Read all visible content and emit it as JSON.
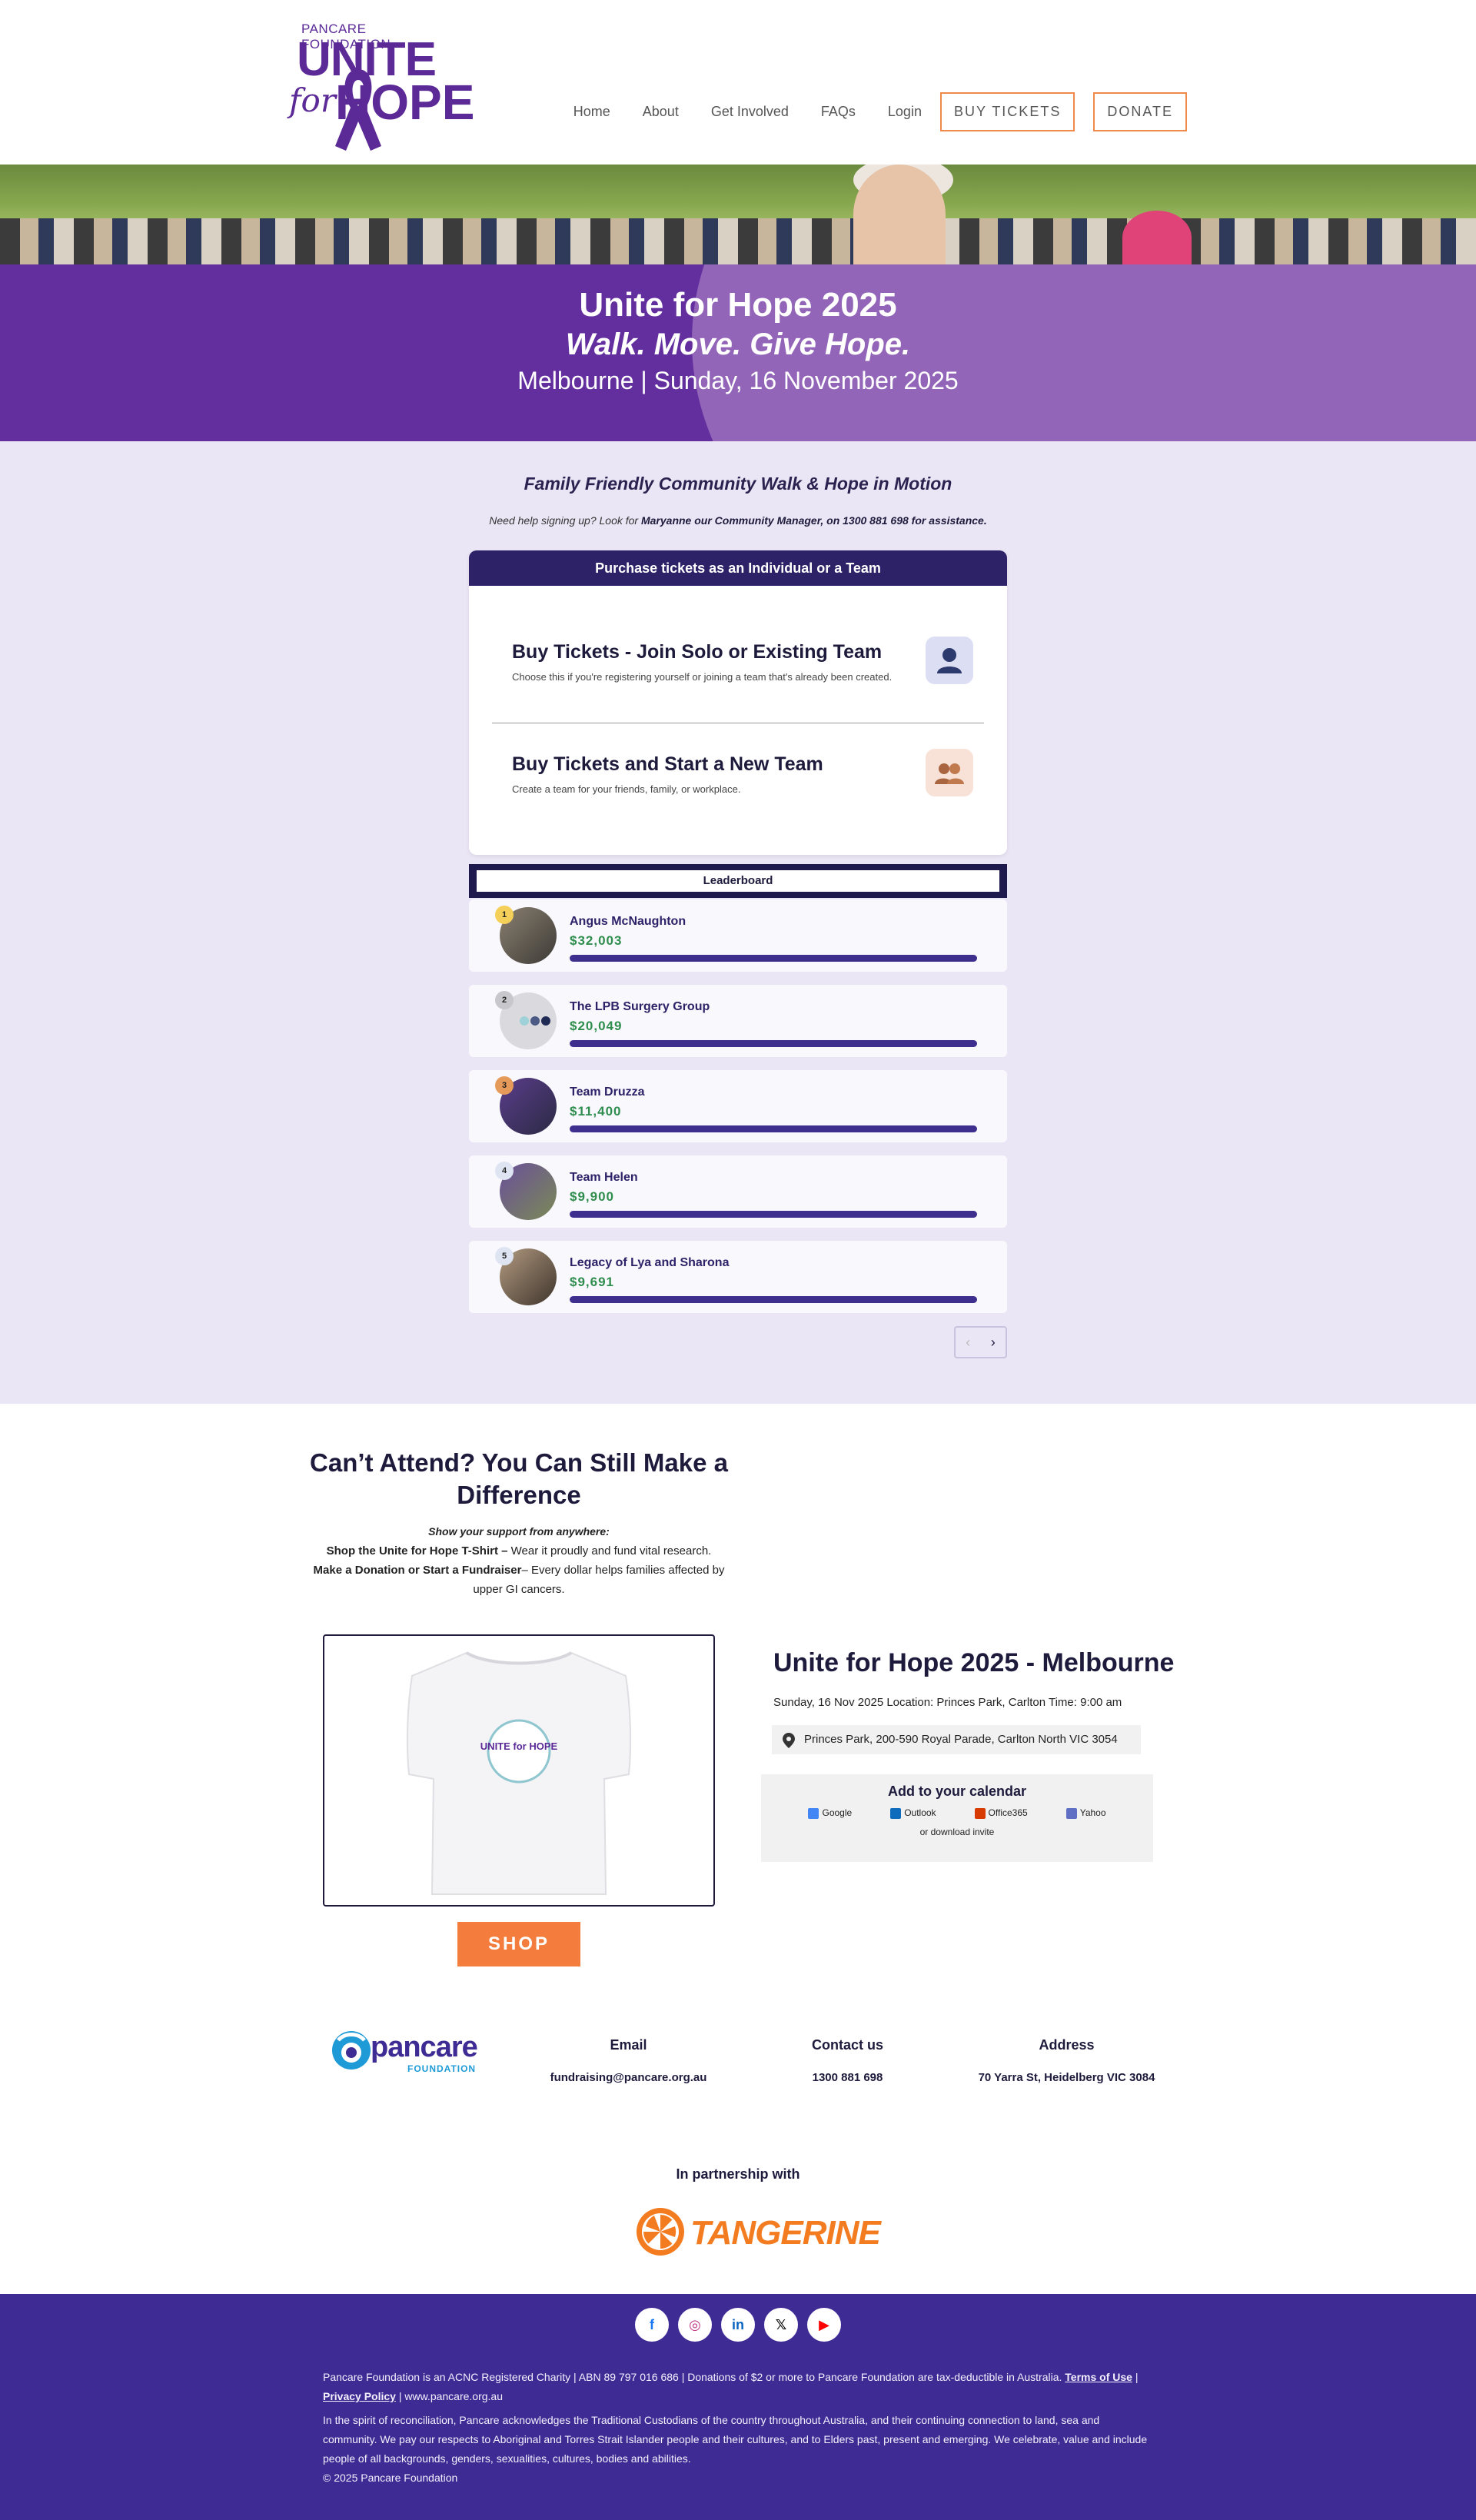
{
  "header": {
    "logo_small": "PANCARE FOUNDATION",
    "logo_unite": "UNITE",
    "logo_for": "for",
    "logo_hope": "HOPE",
    "nav": [
      "Home",
      "About",
      "Get Involved",
      "FAQs",
      "Login"
    ],
    "buy_tickets": "BUY TICKETS",
    "donate": "DONATE"
  },
  "hero": {
    "title": "Unite for Hope 2025",
    "slogan": "Walk. Move. Give Hope.",
    "when": "Melbourne | Sunday, 16 November 2025"
  },
  "intro": {
    "tagline": "Family Friendly Community Walk & Hope in Motion",
    "help_prefix": "Need help signing up? Look for ",
    "help_bold": "Maryanne our Community Manager, on 1300 881 698 for assistance."
  },
  "tickets": {
    "header": "Purchase tickets as an Individual or a Team",
    "options": [
      {
        "title": "Buy Tickets - Join Solo or Existing Team",
        "desc": "Choose this if you're registering yourself or joining a team that's already been created.",
        "icon": "person-icon"
      },
      {
        "title": "Buy Tickets and Start a New Team",
        "desc": "Create a team for your friends, family, or workplace.",
        "icon": "group-icon"
      }
    ]
  },
  "leaderboard": {
    "title": "Leaderboard",
    "rows": [
      {
        "rank": "1",
        "name": "Angus McNaughton",
        "amount": "$32,003",
        "progress": 1.0
      },
      {
        "rank": "2",
        "name": "The LPB Surgery Group",
        "amount": "$20,049",
        "progress": 1.0
      },
      {
        "rank": "3",
        "name": "Team Druzza",
        "amount": "$11,400",
        "progress": 1.0
      },
      {
        "rank": "4",
        "name": "Team Helen",
        "amount": "$9,900",
        "progress": 1.0
      },
      {
        "rank": "5",
        "name": "Legacy of Lya and Sharona",
        "amount": "$9,691",
        "progress": 1.0
      }
    ],
    "prev": "‹",
    "next": "›"
  },
  "cant_attend": {
    "title": "Can’t Attend? You Can Still Make a Difference",
    "support": "Show your support from anywhere:",
    "line1_bold": "Shop the Unite for Hope T-Shirt –",
    "line1": " Wear it proudly and fund vital research.",
    "line2_bold": "Make a Donation or Start a Fundraiser",
    "line2": "– Every dollar helps families affected by upper GI cancers.",
    "shirt_logo": "UNITE for HOPE",
    "shop": "SHOP"
  },
  "event": {
    "title": "Unite for Hope 2025 - Melbourne",
    "details": "Sunday, 16 Nov 2025 Location: Princes Park, Carlton Time: 9:00 am",
    "address": "Princes Park, 200-590 Royal Parade, Carlton North VIC 3054",
    "calendar_title": "Add to your calendar",
    "calendars": [
      "Google",
      "Outlook",
      "Office365",
      "Yahoo"
    ],
    "download": "or download invite"
  },
  "contacts": {
    "logo_text": "pancare",
    "logo_sub": "FOUNDATION",
    "email_label": "Email",
    "email": "fundraising@pancare.org.au",
    "contact_label": "Contact us",
    "phone": "1300 881 698",
    "address_label": "Address",
    "address": "70 Yarra St, Heidelberg VIC 3084"
  },
  "partner": {
    "label": "In partnership with",
    "name": "TANGERINE"
  },
  "footer": {
    "socials": [
      "f",
      "◎",
      "in",
      "𝕏",
      "▶"
    ],
    "charity": "Pancare Foundation is an ACNC Registered Charity | ABN 89 797 016 686 | Donations of $2 or more to Pancare Foundation are tax-deductible in Australia. ",
    "terms": "Terms of Use",
    "sep": " |",
    "privacy": "Privacy Policy",
    "site": " | www.pancare.org.au",
    "acknowledgement": "In the spirit of reconciliation, Pancare acknowledges the Traditional Custodians of the country throughout Australia, and their continuing connection to land, sea and community. We pay our respects to Aboriginal and Torres Strait Islander people and their cultures, and to Elders past, present and emerging. We celebrate, value and include people of all backgrounds, genders, sexualities, cultures, bodies and abilities.",
    "copyright": "© 2025 Pancare Foundation"
  },
  "colors": {
    "brand": "#632f9f",
    "accent": "#f47c3c",
    "navy": "#2d2167",
    "money": "#2f8d4e"
  }
}
